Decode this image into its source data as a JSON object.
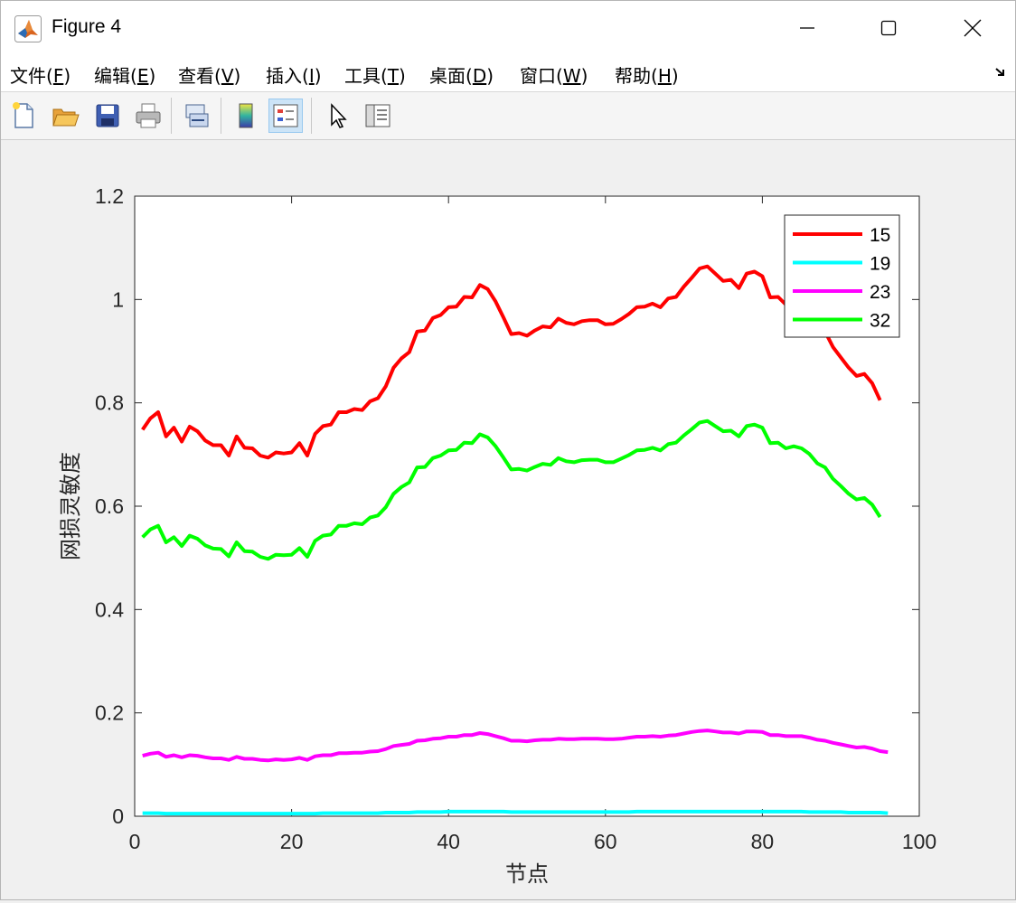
{
  "window": {
    "title": "Figure 4",
    "minimize_icon": "minimize-icon",
    "maximize_icon": "maximize-icon",
    "close_icon": "close-icon"
  },
  "menu": [
    {
      "label": "文件(",
      "key": "F",
      "end": ")"
    },
    {
      "label": "编辑(",
      "key": "E",
      "end": ")"
    },
    {
      "label": "查看(",
      "key": "V",
      "end": ")"
    },
    {
      "label": "插入(",
      "key": "I",
      "end": ")"
    },
    {
      "label": "工具(",
      "key": "T",
      "end": ")"
    },
    {
      "label": "桌面(",
      "key": "D",
      "end": ")"
    },
    {
      "label": "窗口(",
      "key": "W",
      "end": ")"
    },
    {
      "label": "帮助(",
      "key": "H",
      "end": ")"
    }
  ],
  "toolbar": [
    "new-figure-icon",
    "open-file-icon",
    "save-icon",
    "print-icon",
    "link-plot-icon",
    "colorbar-icon",
    "legend-icon",
    "pointer-icon",
    "property-inspector-icon"
  ],
  "chart_data": {
    "type": "line",
    "title": "",
    "xlabel": "节点",
    "ylabel": "网损灵敏度",
    "xlim": [
      0,
      100
    ],
    "ylim": [
      0,
      1.2
    ],
    "xticks": [
      "0",
      "20",
      "40",
      "60",
      "80",
      "100"
    ],
    "yticks": [
      "0",
      "0.2",
      "0.4",
      "0.6",
      "0.8",
      "1",
      "1.2"
    ],
    "legend_position": "top-right",
    "x": [
      1,
      2,
      3,
      4,
      5,
      6,
      7,
      8,
      9,
      10,
      11,
      12,
      13,
      14,
      15,
      16,
      17,
      18,
      19,
      20,
      21,
      22,
      23,
      24,
      25,
      26,
      27,
      28,
      29,
      30,
      31,
      32,
      33,
      34,
      35,
      36,
      37,
      38,
      39,
      40,
      41,
      42,
      43,
      44,
      45,
      46,
      47,
      48,
      49,
      50,
      51,
      52,
      53,
      54,
      55,
      56,
      57,
      58,
      59,
      60,
      61,
      62,
      63,
      64,
      65,
      66,
      67,
      68,
      69,
      70,
      71,
      72,
      73,
      74,
      75,
      76,
      77,
      78,
      79,
      80,
      81,
      82,
      83,
      84,
      85,
      86,
      87,
      88,
      89,
      90,
      91,
      92,
      93,
      94,
      95,
      96
    ],
    "series": [
      {
        "name": "15",
        "color": "#ff0000",
        "values": [
          0.748,
          0.77,
          0.782,
          0.735,
          0.752,
          0.725,
          0.754,
          0.745,
          0.727,
          0.718,
          0.718,
          0.698,
          0.735,
          0.713,
          0.712,
          0.698,
          0.694,
          0.704,
          0.702,
          0.704,
          0.722,
          0.698,
          0.74,
          0.755,
          0.758,
          0.782,
          0.782,
          0.788,
          0.786,
          0.803,
          0.809,
          0.832,
          0.868,
          0.886,
          0.898,
          0.938,
          0.94,
          0.964,
          0.97,
          0.985,
          0.986,
          1.005,
          1.004,
          1.028,
          1.02,
          0.996,
          0.965,
          0.933,
          0.935,
          0.93,
          0.94,
          0.948,
          0.946,
          0.963,
          0.955,
          0.952,
          0.958,
          0.96,
          0.96,
          0.952,
          0.953,
          0.962,
          0.972,
          0.985,
          0.986,
          0.992,
          0.985,
          1.002,
          1.005,
          1.025,
          1.042,
          1.06,
          1.064,
          1.05,
          1.036,
          1.038,
          1.022,
          1.05,
          1.054,
          1.045,
          1.004,
          1.005,
          0.99,
          0.995,
          0.99,
          0.975,
          0.95,
          0.938,
          0.908,
          0.888,
          0.868,
          0.852,
          0.856,
          0.838,
          0.805
        ]
      },
      {
        "name": "19",
        "color": "#00ffff",
        "values": [
          0.006,
          0.006,
          0.006,
          0.005,
          0.005,
          0.005,
          0.005,
          0.005,
          0.005,
          0.005,
          0.005,
          0.005,
          0.005,
          0.005,
          0.005,
          0.005,
          0.005,
          0.005,
          0.005,
          0.005,
          0.005,
          0.005,
          0.005,
          0.006,
          0.006,
          0.006,
          0.006,
          0.006,
          0.006,
          0.006,
          0.006,
          0.007,
          0.007,
          0.007,
          0.007,
          0.008,
          0.008,
          0.008,
          0.008,
          0.009,
          0.009,
          0.009,
          0.009,
          0.009,
          0.009,
          0.009,
          0.009,
          0.008,
          0.008,
          0.008,
          0.008,
          0.008,
          0.008,
          0.008,
          0.008,
          0.008,
          0.008,
          0.008,
          0.008,
          0.008,
          0.008,
          0.008,
          0.008,
          0.009,
          0.009,
          0.009,
          0.009,
          0.009,
          0.009,
          0.009,
          0.009,
          0.009,
          0.009,
          0.009,
          0.009,
          0.009,
          0.009,
          0.009,
          0.009,
          0.009,
          0.009,
          0.009,
          0.009,
          0.009,
          0.009,
          0.008,
          0.008,
          0.008,
          0.008,
          0.008,
          0.007,
          0.007,
          0.007,
          0.007,
          0.007,
          0.006
        ]
      },
      {
        "name": "23",
        "color": "#ff00ff",
        "values": [
          0.117,
          0.121,
          0.123,
          0.115,
          0.118,
          0.114,
          0.118,
          0.117,
          0.114,
          0.112,
          0.112,
          0.109,
          0.115,
          0.111,
          0.111,
          0.109,
          0.108,
          0.11,
          0.109,
          0.11,
          0.113,
          0.109,
          0.116,
          0.118,
          0.118,
          0.122,
          0.122,
          0.123,
          0.123,
          0.125,
          0.126,
          0.13,
          0.136,
          0.138,
          0.14,
          0.146,
          0.147,
          0.15,
          0.151,
          0.154,
          0.154,
          0.157,
          0.157,
          0.161,
          0.159,
          0.155,
          0.151,
          0.146,
          0.146,
          0.145,
          0.147,
          0.148,
          0.148,
          0.15,
          0.149,
          0.149,
          0.15,
          0.15,
          0.15,
          0.149,
          0.149,
          0.15,
          0.152,
          0.154,
          0.154,
          0.155,
          0.154,
          0.156,
          0.157,
          0.16,
          0.163,
          0.165,
          0.166,
          0.164,
          0.162,
          0.162,
          0.16,
          0.164,
          0.164,
          0.163,
          0.157,
          0.157,
          0.155,
          0.155,
          0.155,
          0.152,
          0.148,
          0.146,
          0.142,
          0.139,
          0.136,
          0.133,
          0.134,
          0.131,
          0.126,
          0.124
        ]
      },
      {
        "name": "32",
        "color": "#00ff00",
        "values": [
          0.54,
          0.555,
          0.562,
          0.53,
          0.54,
          0.523,
          0.543,
          0.537,
          0.524,
          0.518,
          0.517,
          0.503,
          0.53,
          0.513,
          0.512,
          0.502,
          0.498,
          0.506,
          0.505,
          0.506,
          0.519,
          0.502,
          0.533,
          0.543,
          0.545,
          0.562,
          0.562,
          0.567,
          0.565,
          0.578,
          0.582,
          0.598,
          0.624,
          0.637,
          0.646,
          0.675,
          0.676,
          0.693,
          0.698,
          0.708,
          0.709,
          0.723,
          0.722,
          0.739,
          0.733,
          0.716,
          0.694,
          0.671,
          0.672,
          0.669,
          0.676,
          0.682,
          0.68,
          0.693,
          0.687,
          0.685,
          0.689,
          0.69,
          0.69,
          0.685,
          0.685,
          0.692,
          0.699,
          0.708,
          0.709,
          0.713,
          0.708,
          0.72,
          0.723,
          0.737,
          0.749,
          0.762,
          0.765,
          0.755,
          0.745,
          0.746,
          0.735,
          0.755,
          0.758,
          0.752,
          0.722,
          0.723,
          0.712,
          0.716,
          0.712,
          0.701,
          0.683,
          0.675,
          0.653,
          0.639,
          0.624,
          0.613,
          0.616,
          0.603,
          0.579
        ]
      }
    ]
  }
}
